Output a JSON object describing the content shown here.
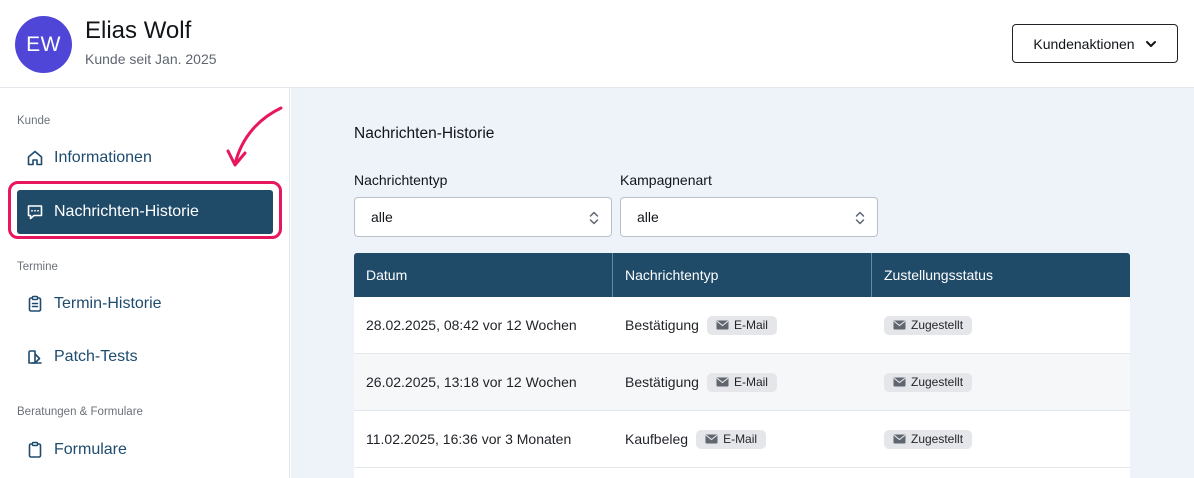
{
  "customer": {
    "initials": "EW",
    "name": "Elias Wolf",
    "since": "Kunde seit Jan. 2025"
  },
  "header": {
    "actions_label": "Kundenaktionen"
  },
  "sidebar": {
    "sections": {
      "kunde": "Kunde",
      "termine": "Termine",
      "beratungen": "Beratungen & Formulare"
    },
    "items": [
      {
        "label": "Informationen",
        "icon": "home-icon"
      },
      {
        "label": "Nachrichten-Historie",
        "icon": "chat-icon",
        "active": true
      },
      {
        "label": "Termin-Historie",
        "icon": "clipboard-list-icon"
      },
      {
        "label": "Patch-Tests",
        "icon": "patch-icon"
      },
      {
        "label": "Formulare",
        "icon": "clipboard-icon"
      }
    ]
  },
  "main": {
    "title": "Nachrichten-Historie",
    "filters": [
      {
        "label": "Nachrichtentyp",
        "value": "alle"
      },
      {
        "label": "Kampagnenart",
        "value": "alle"
      }
    ],
    "table": {
      "columns": [
        "Datum",
        "Nachrichtentyp",
        "Zustellungsstatus"
      ],
      "rows": [
        {
          "date": "28.02.2025, 08:42 vor 12 Wochen",
          "type": "Bestätigung",
          "channel": "E-Mail",
          "status": "Zugestellt"
        },
        {
          "date": "26.02.2025, 13:18 vor 12 Wochen",
          "type": "Bestätigung",
          "channel": "E-Mail",
          "status": "Zugestellt"
        },
        {
          "date": "11.02.2025, 16:36 vor 3 Monaten",
          "type": "Kaufbeleg",
          "channel": "E-Mail",
          "status": "Zugestellt"
        }
      ]
    }
  },
  "colors": {
    "accent": "#1f4a68",
    "avatar": "#4f46d8",
    "highlight": "#e8175d",
    "main_bg": "#edf3f9"
  }
}
